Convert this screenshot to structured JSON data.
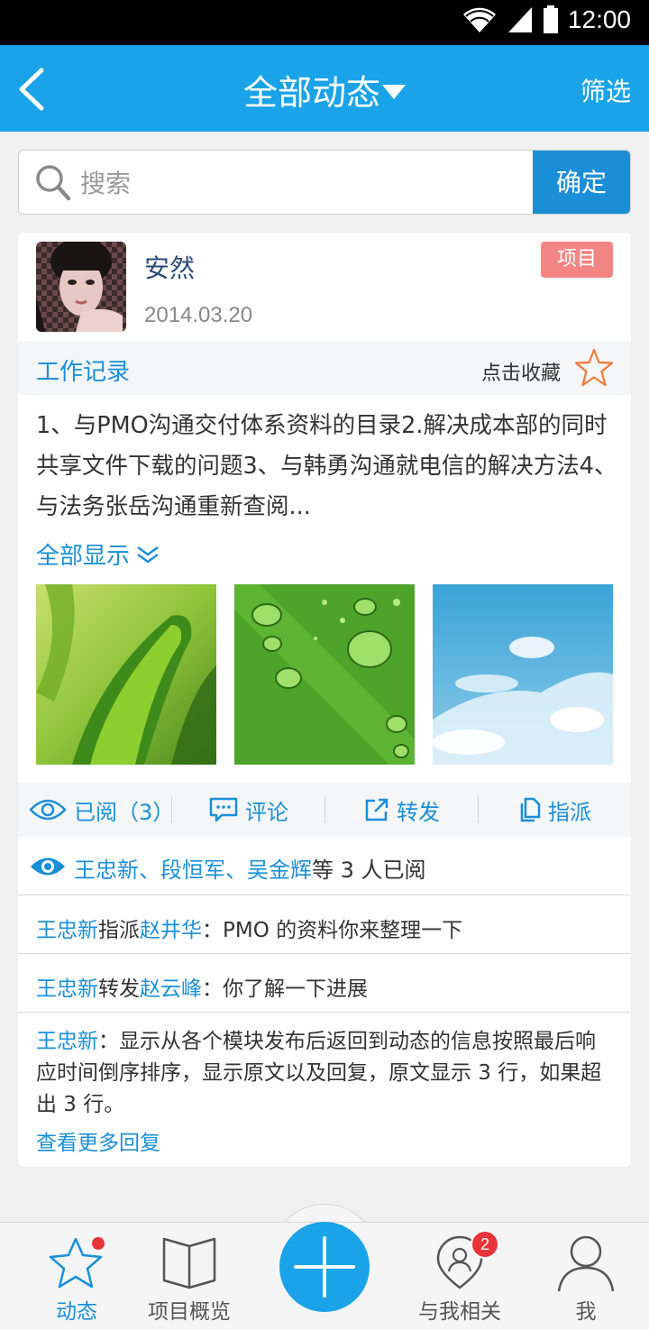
{
  "status_bar": {
    "time": "12:00"
  },
  "header": {
    "title": "全部动态",
    "filter_label": "筛选"
  },
  "search": {
    "placeholder": "搜索",
    "confirm_label": "确定"
  },
  "post": {
    "user_name": "安然",
    "date": "2014.03.20",
    "tag": "项目",
    "category": "工作记录",
    "favorite_label": "点击收藏",
    "content": "1、与PMO沟通交付体系资料的目录2.解决成本部的同时共享文件下载的问题3、与韩勇沟通就电信的解决方法4、与法务张岳沟通重新查阅...",
    "show_all_label": "全部显示",
    "images": [
      "grass-blade-image",
      "water-drops-leaf-image",
      "blue-sky-clouds-image"
    ],
    "actions": {
      "read": "已阅（3）",
      "comment": "评论",
      "forward": "转发",
      "assign": "指派"
    },
    "readers": {
      "names": "王忠新、段恒军、吴金辉",
      "suffix": "等 3 人已阅"
    },
    "replies": [
      {
        "from": "王忠新",
        "verb": "指派",
        "to": "赵井华",
        "colon": "：",
        "text": "PMO 的资料你来整理一下"
      },
      {
        "from": "王忠新",
        "verb": "转发",
        "to": "赵云峰",
        "colon": "：",
        "text": "你了解一下进展"
      },
      {
        "from": "王忠新",
        "colon": "：",
        "text": "显示从各个模块发布后返回到动态的信息按照最后响应时间倒序排序，显示原文以及回复，原文显示 3 行，如果超出 3 行。"
      }
    ],
    "more_replies_label": "查看更多回复"
  },
  "tabbar": {
    "items": [
      {
        "label": "动态",
        "icon": "star-icon",
        "active": true
      },
      {
        "label": "项目概览",
        "icon": "book-icon"
      },
      {
        "label": "",
        "icon": "plus-icon"
      },
      {
        "label": "与我相关",
        "icon": "user-pin-icon",
        "badge": "2"
      },
      {
        "label": "我",
        "icon": "person-icon"
      }
    ]
  },
  "colors": {
    "primary": "#1aa3e8",
    "link": "#1a8fd8",
    "tag": "#f48585",
    "badge": "#e8353b",
    "star": "#f07a3a"
  }
}
